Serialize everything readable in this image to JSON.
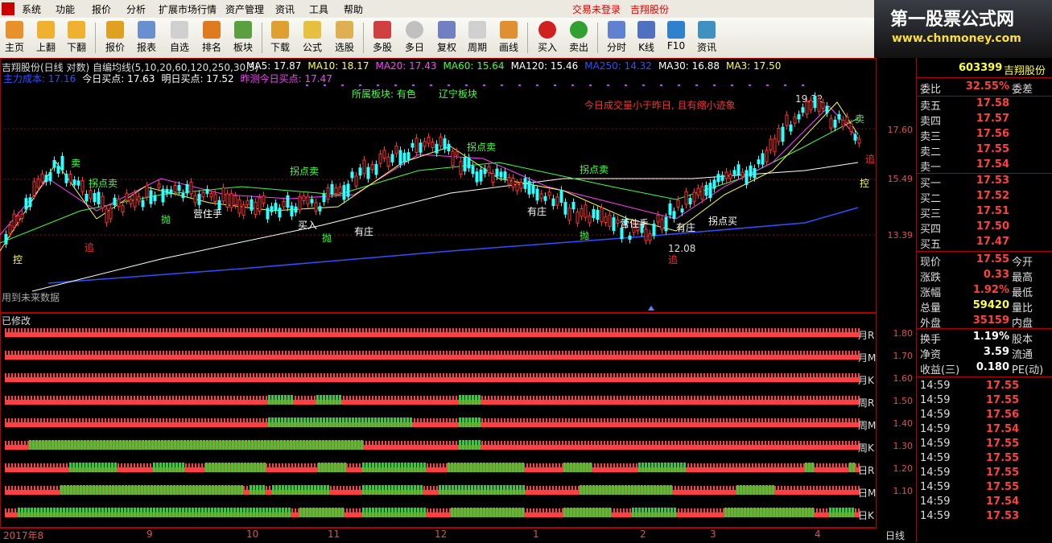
{
  "menu": {
    "items": [
      "系统",
      "功能",
      "报价",
      "分析",
      "扩展市场行情",
      "资产管理",
      "资讯",
      "工具",
      "帮助"
    ],
    "trade_status": "交易未登录",
    "stock_name": "吉翔股份"
  },
  "toolbar": {
    "buttons": [
      "主页",
      "上翻",
      "下翻",
      "报价",
      "报表",
      "自选",
      "排名",
      "板块",
      "下载",
      "公式",
      "选股",
      "多股",
      "多日",
      "复权",
      "周期",
      "画线",
      "买入",
      "卖出",
      "分时",
      "K线",
      "F10",
      "资讯"
    ]
  },
  "brand": {
    "title": "第一股票公式网",
    "url": "www.chnmoney.com"
  },
  "chart": {
    "header": "吉翔股份(日线 对数) 自编均线(5,10,20,60,120,250,30,3)",
    "ma": [
      {
        "label": "MA5: 17.87",
        "color": "#ffffff"
      },
      {
        "label": "MA10: 18.17",
        "color": "#ffff40"
      },
      {
        "label": "MA20: 17.43",
        "color": "#ff40ff"
      },
      {
        "label": "MA60: 15.64",
        "color": "#40ff40"
      },
      {
        "label": "MA120: 15.46",
        "color": "#ffffff"
      },
      {
        "label": "MA250: 14.32",
        "color": "#3050ff"
      },
      {
        "label": "MA30: 16.88",
        "color": "#ffffff"
      },
      {
        "label": "MA3: 17.50",
        "color": "#ffff40"
      }
    ],
    "line2": [
      {
        "label": "主力成本: 17.16",
        "color": "#3050ff"
      },
      {
        "label": "今日买点: 17.63",
        "color": "#ffffff"
      },
      {
        "label": "明日买点: 17.52",
        "color": "#ffffff"
      },
      {
        "label": "昨测今日买点: 17.47",
        "color": "#ff40ff"
      }
    ],
    "sector1": "所属板块: 有色",
    "sector2": "辽宁板块",
    "warning": "今日成交量小于昨日, 且有缩小迹象",
    "high_label": "19.32",
    "low_label": "12.08",
    "future_note": "用到未来数据",
    "price_axis": [
      "17.60",
      "15.49",
      "13.39"
    ],
    "lower_title": "已修改",
    "lower_rows": [
      {
        "label": "月R",
        "value": "1.80"
      },
      {
        "label": "月M",
        "value": "1.70"
      },
      {
        "label": "月K",
        "value": "1.60"
      },
      {
        "label": "周R",
        "value": "1.50"
      },
      {
        "label": "周M",
        "value": "1.40"
      },
      {
        "label": "周K",
        "value": "1.30"
      },
      {
        "label": "日R",
        "value": "1.20"
      },
      {
        "label": "日M",
        "value": "1.10"
      },
      {
        "label": "日K",
        "value": ""
      }
    ],
    "time_axis": [
      "2017年8",
      "9",
      "10",
      "11",
      "12",
      "1",
      "2",
      "3",
      "4"
    ],
    "period": "日线",
    "annotations": [
      "卖",
      "拐点卖",
      "控",
      "抛",
      "追",
      "有庄",
      "买入",
      "营住手",
      "拐点买",
      "控",
      "追"
    ]
  },
  "quote": {
    "code": "603399",
    "name": "吉翔股份",
    "weibi": {
      "k": "委比",
      "v": "32.55%",
      "k2": "委差"
    },
    "asks": [
      {
        "k": "卖五",
        "v": "17.58"
      },
      {
        "k": "卖四",
        "v": "17.57"
      },
      {
        "k": "卖三",
        "v": "17.56"
      },
      {
        "k": "卖二",
        "v": "17.55"
      },
      {
        "k": "卖一",
        "v": "17.54"
      }
    ],
    "bids": [
      {
        "k": "买一",
        "v": "17.53"
      },
      {
        "k": "买二",
        "v": "17.52"
      },
      {
        "k": "买三",
        "v": "17.51"
      },
      {
        "k": "买四",
        "v": "17.50"
      },
      {
        "k": "买五",
        "v": "17.47"
      }
    ],
    "stats": [
      {
        "k": "现价",
        "v": "17.55",
        "k2": "今开",
        "c": "#ff4040"
      },
      {
        "k": "涨跌",
        "v": "0.33",
        "k2": "最高",
        "c": "#ff4040"
      },
      {
        "k": "涨幅",
        "v": "1.92%",
        "k2": "最低",
        "c": "#ff4040"
      },
      {
        "k": "总量",
        "v": "59420",
        "k2": "量比",
        "c": "#ffff40"
      },
      {
        "k": "外盘",
        "v": "35159",
        "k2": "内盘",
        "c": "#ff4040"
      }
    ],
    "fin": [
      {
        "k": "换手",
        "v": "1.19%",
        "k2": "股本"
      },
      {
        "k": "净资",
        "v": "3.59",
        "k2": "流通"
      },
      {
        "k": "收益(三)",
        "v": "0.180",
        "k2": "PE(动)"
      }
    ],
    "ticks": [
      {
        "t": "14:59",
        "p": "17.55"
      },
      {
        "t": "14:59",
        "p": "17.55"
      },
      {
        "t": "14:59",
        "p": "17.56"
      },
      {
        "t": "14:59",
        "p": "17.54"
      },
      {
        "t": "14:59",
        "p": "17.55"
      },
      {
        "t": "14:59",
        "p": "17.55"
      },
      {
        "t": "14:59",
        "p": "17.55"
      },
      {
        "t": "14:59",
        "p": "17.55"
      },
      {
        "t": "14:59",
        "p": "17.54"
      },
      {
        "t": "14:59",
        "p": "17.53"
      }
    ]
  }
}
